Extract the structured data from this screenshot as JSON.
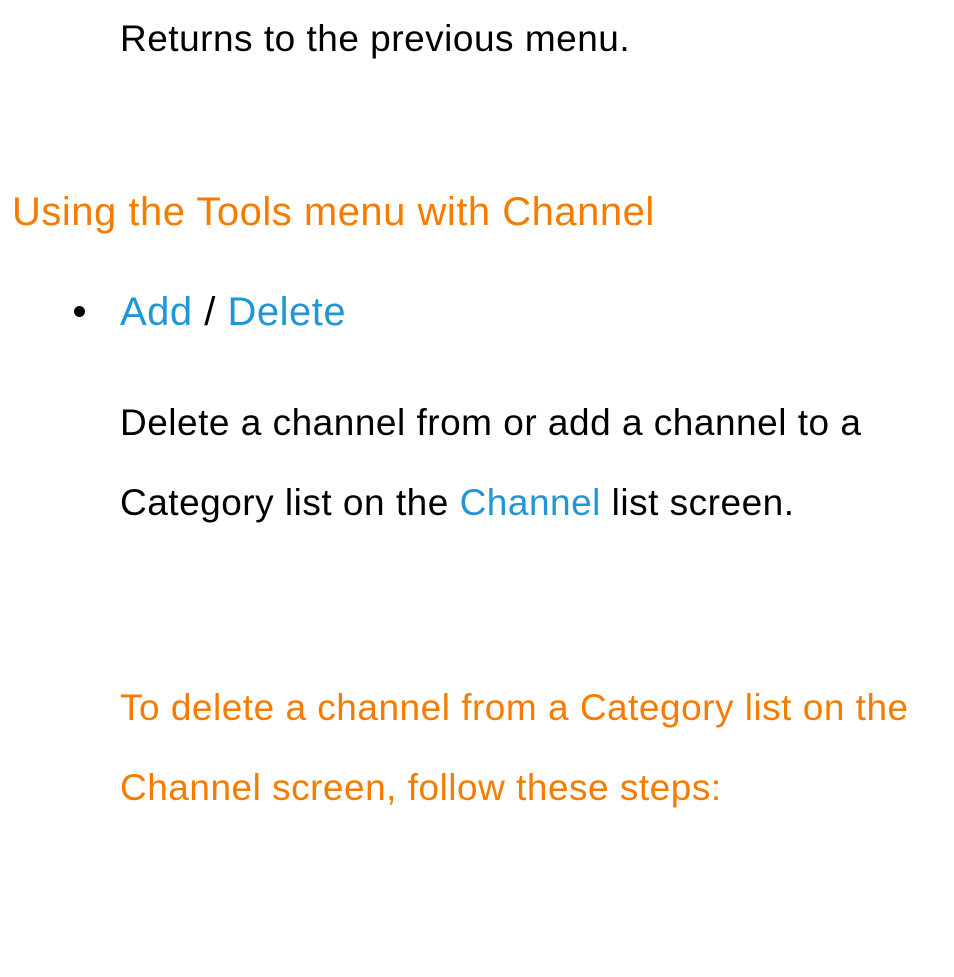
{
  "returnText": "Returns to the previous menu.",
  "sectionHeading": "Using the Tools menu with Channel",
  "bullet": {
    "titleParts": {
      "add": "Add",
      "separator": " / ",
      "delete": "Delete"
    },
    "descriptionParts": {
      "before": "Delete a channel from or add a channel to a Category list on the ",
      "channel": "Channel",
      "after": " list screen."
    }
  },
  "orangeInstruction": "To delete a channel from a Category list on the Channel screen, follow these steps:"
}
